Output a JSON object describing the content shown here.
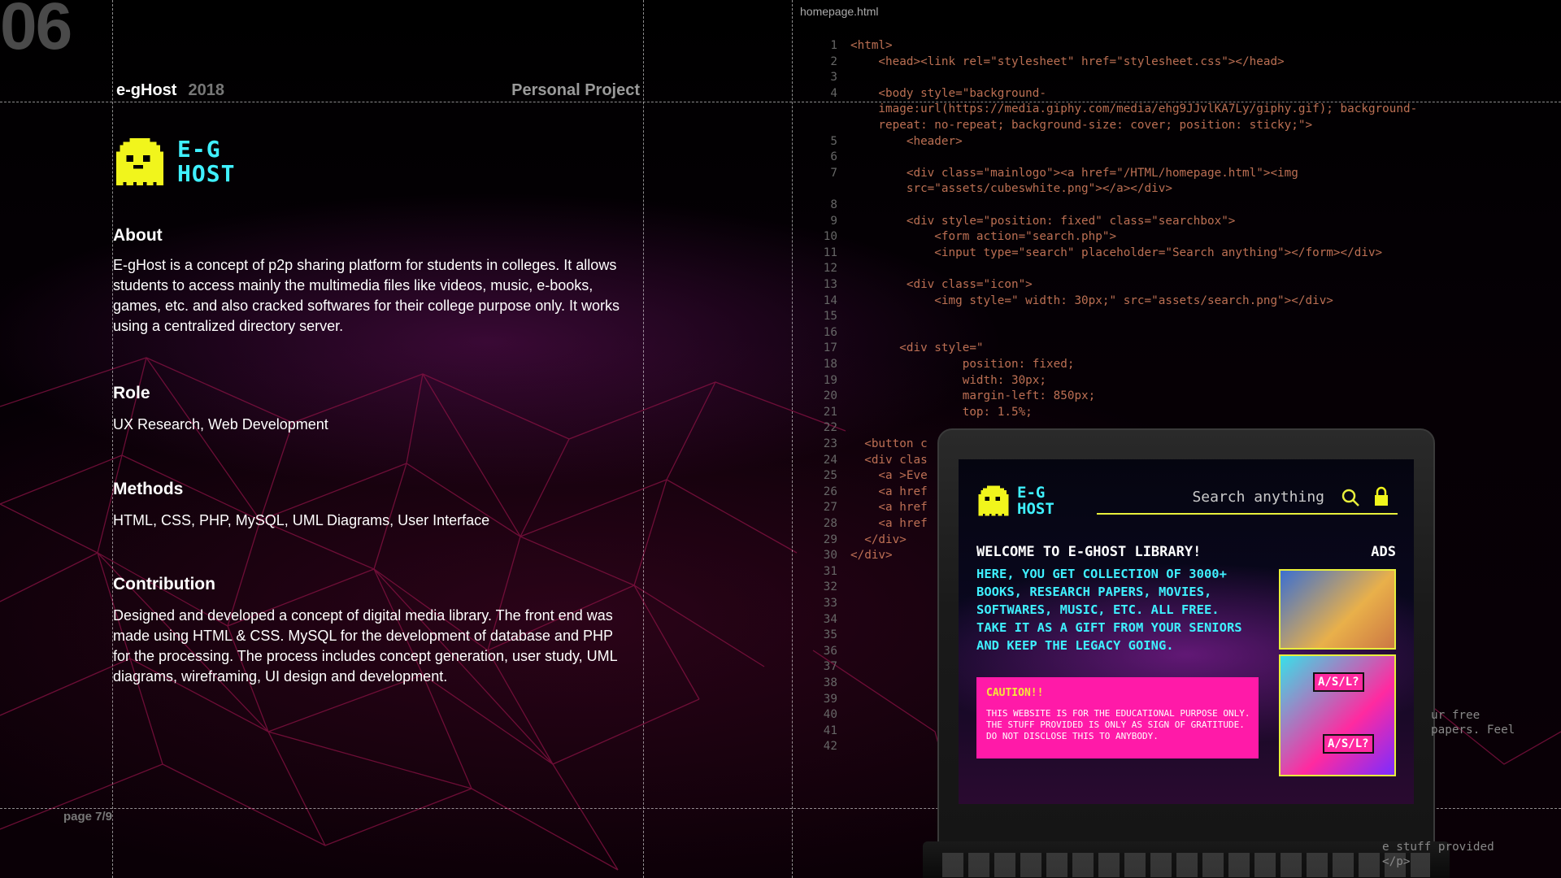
{
  "page_number": "06",
  "project": {
    "name": "e-gHost",
    "year": "2018",
    "type": "Personal Project"
  },
  "logo": {
    "line1": "E-G",
    "line2": "HOST"
  },
  "sections": {
    "about": {
      "title": "About",
      "text": "E-gHost is a concept of  p2p sharing platform for students in colleges. It allows students to access mainly the multimedia files like videos, music, e-books, games, etc. and also cracked softwares for their college purpose only. It works using a centralized directory server."
    },
    "role": {
      "title": "Role",
      "text": "UX Research, Web Development"
    },
    "methods": {
      "title": "Methods",
      "text": "HTML, CSS, PHP, MySQL, UML Diagrams, User Interface"
    },
    "contribution": {
      "title": "Contribution",
      "text": "Designed and developed a concept of digital media library. The front end was made using HTML & CSS. MySQL for the development of database and PHP for the processing. The process includes concept generation, user study, UML diagrams, wireframing, UI design and development."
    }
  },
  "footer": "page 7/9",
  "editor": {
    "filename": "homepage.html",
    "lines": [
      {
        "n": "1",
        "t": "<html>"
      },
      {
        "n": "2",
        "t": "    <head><link rel=\"stylesheet\" href=\"stylesheet.css\"></head>"
      },
      {
        "n": "3",
        "t": ""
      },
      {
        "n": "4",
        "t": "    <body style=\"background-"
      },
      {
        "n": "",
        "t": "    image:url(https://media.giphy.com/media/ehg9JJvlKA7Ly/giphy.gif); background-"
      },
      {
        "n": "",
        "t": "    repeat: no-repeat; background-size: cover; position: sticky;\">"
      },
      {
        "n": "5",
        "t": "        <header>"
      },
      {
        "n": "6",
        "t": ""
      },
      {
        "n": "7",
        "t": "        <div class=\"mainlogo\"><a href=\"/HTML/homepage.html\"><img"
      },
      {
        "n": "",
        "t": "        src=\"assets/cubeswhite.png\"></a></div>"
      },
      {
        "n": "8",
        "t": ""
      },
      {
        "n": "9",
        "t": "        <div style=\"position: fixed\" class=\"searchbox\">"
      },
      {
        "n": "10",
        "t": "            <form action=\"search.php\">"
      },
      {
        "n": "11",
        "t": "            <input type=\"search\" placeholder=\"Search anything\"></form></div>"
      },
      {
        "n": "12",
        "t": ""
      },
      {
        "n": "13",
        "t": "        <div class=\"icon\">"
      },
      {
        "n": "14",
        "t": "            <img style=\" width: 30px;\" src=\"assets/search.png\"></div>"
      },
      {
        "n": "15",
        "t": ""
      },
      {
        "n": "16",
        "t": ""
      },
      {
        "n": "17",
        "t": "       <div style=\""
      },
      {
        "n": "18",
        "t": "                position: fixed;"
      },
      {
        "n": "19",
        "t": "                width: 30px;"
      },
      {
        "n": "20",
        "t": "                margin-left: 850px;"
      },
      {
        "n": "21",
        "t": "                top: 1.5%;"
      },
      {
        "n": "22",
        "t": ""
      },
      {
        "n": "23",
        "t": "  <button c"
      },
      {
        "n": "24",
        "t": "  <div clas"
      },
      {
        "n": "25",
        "t": "    <a >Eve"
      },
      {
        "n": "26",
        "t": "    <a href"
      },
      {
        "n": "27",
        "t": "    <a href"
      },
      {
        "n": "28",
        "t": "    <a href"
      },
      {
        "n": "29",
        "t": "  </div>"
      },
      {
        "n": "30",
        "t": "</div>"
      },
      {
        "n": "31",
        "t": ""
      },
      {
        "n": "32",
        "t": ""
      },
      {
        "n": "33",
        "t": ""
      },
      {
        "n": "34",
        "t": ""
      },
      {
        "n": "35",
        "t": ""
      },
      {
        "n": "36",
        "t": ""
      },
      {
        "n": "37",
        "t": ""
      },
      {
        "n": "38",
        "t": ""
      },
      {
        "n": "39",
        "t": ""
      },
      {
        "n": "40",
        "t": ""
      },
      {
        "n": "41",
        "t": ""
      },
      {
        "n": "42",
        "t": ""
      }
    ],
    "right_fragments": [
      "ur free",
      "papers. Feel",
      "e stuff provided",
      "</p>"
    ]
  },
  "laptop_screen": {
    "logo_line1": "E-G",
    "logo_line2": "HOST",
    "search_placeholder": "Search anything",
    "welcome": "WELCOME TO E-GHOST LIBRARY!",
    "ads_label": "ADS",
    "intro": "HERE, YOU GET COLLECTION OF 3000+ BOOKS, RESEARCH PAPERS, MOVIES, SOFTWARES, MUSIC, ETC. ALL FREE. TAKE IT AS A GIFT FROM YOUR SENIORS AND KEEP THE LEGACY GOING.",
    "caution_title": "CAUTION!!",
    "caution_text": "THIS WEBSITE IS FOR THE EDUCATIONAL PURPOSE ONLY. THE STUFF PROVIDED IS ONLY AS SIGN OF GRATITUDE. DO NOT DISCLOSE THIS TO ANYBODY.",
    "ad_tag": "A/S/L?"
  },
  "colors": {
    "accent_cyan": "#3ff0ff",
    "ghost_yellow": "#f1f51c",
    "caution_pink": "#ff1aa8"
  }
}
